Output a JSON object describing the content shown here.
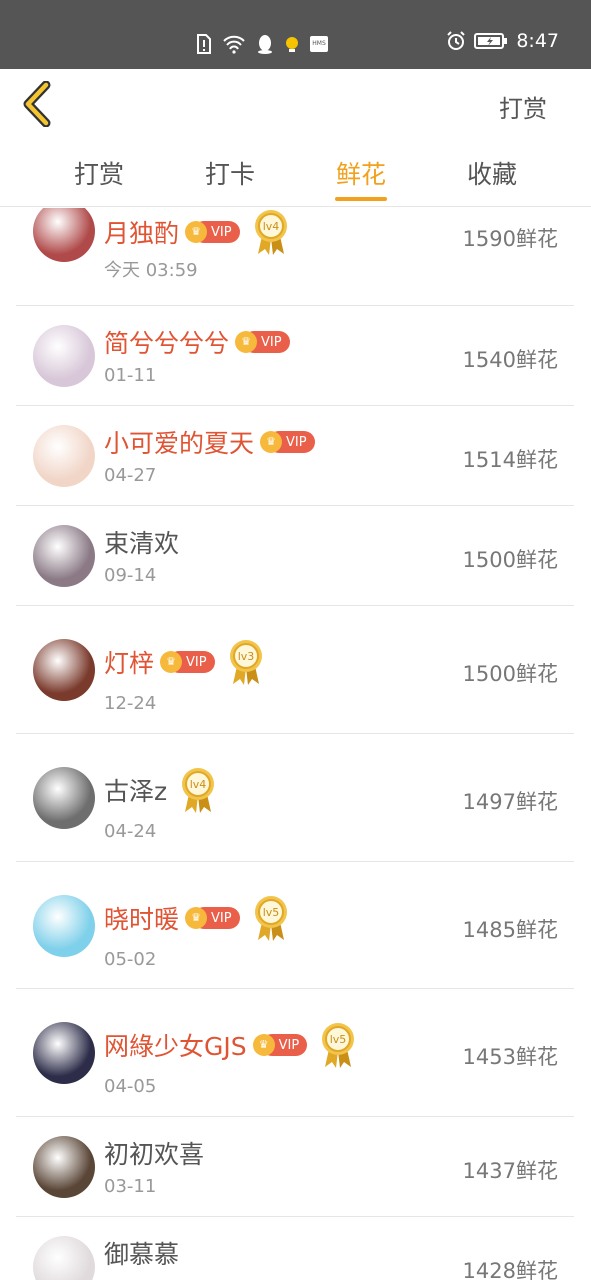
{
  "status_bar": {
    "time": "8:47",
    "icons": [
      "sim-alert-icon",
      "wifi-icon",
      "qq-icon",
      "notification-icon",
      "hms-icon",
      "alarm-icon",
      "battery-icon"
    ],
    "hms_text": "HMS"
  },
  "header": {
    "right_label": "打赏"
  },
  "tabs": [
    {
      "label": "打赏",
      "active": false
    },
    {
      "label": "打卡",
      "active": false
    },
    {
      "label": "鲜花",
      "active": true
    },
    {
      "label": "收藏",
      "active": false
    }
  ],
  "vip_text": "VIP",
  "rows": [
    {
      "name": "月独酌",
      "vip": true,
      "level": "lv4",
      "date": "今天 03:59",
      "amount": "1590鲜花",
      "avatar_color": "#b04a4a"
    },
    {
      "name": "简兮兮兮兮",
      "vip": true,
      "level": null,
      "date": "01-11",
      "amount": "1540鲜花",
      "avatar_color": "#d8c7d8"
    },
    {
      "name": "小可爱的夏天",
      "vip": true,
      "level": null,
      "date": "04-27",
      "amount": "1514鲜花",
      "avatar_color": "#f1d6c8"
    },
    {
      "name": "束清欢",
      "vip": false,
      "level": null,
      "date": "09-14",
      "amount": "1500鲜花",
      "avatar_color": "#8b7a86"
    },
    {
      "name": "灯梓",
      "vip": true,
      "level": "lv3",
      "date": "12-24",
      "amount": "1500鲜花",
      "avatar_color": "#7a3a2c"
    },
    {
      "name": "古泽z",
      "vip": false,
      "level": "lv4",
      "date": "04-24",
      "amount": "1497鲜花",
      "avatar_color": "#6e6e6e"
    },
    {
      "name": "晓时暖",
      "vip": true,
      "level": "lv5",
      "date": "05-02",
      "amount": "1485鲜花",
      "avatar_color": "#7fd0ea"
    },
    {
      "name": "网綠少女GJS",
      "vip": true,
      "level": "lv5",
      "date": "04-05",
      "amount": "1453鲜花",
      "avatar_color": "#2d2d4a"
    },
    {
      "name": "初初欢喜",
      "vip": false,
      "level": null,
      "date": "03-11",
      "amount": "1437鲜花",
      "avatar_color": "#5a4637"
    },
    {
      "name": "御慕慕",
      "vip": false,
      "level": null,
      "date": "",
      "amount": "1428鲜花",
      "avatar_color": "#e0dadd"
    }
  ],
  "colors": {
    "accent": "#f2a11e",
    "vip_name": "#e05434",
    "status_bar": "#555555"
  }
}
